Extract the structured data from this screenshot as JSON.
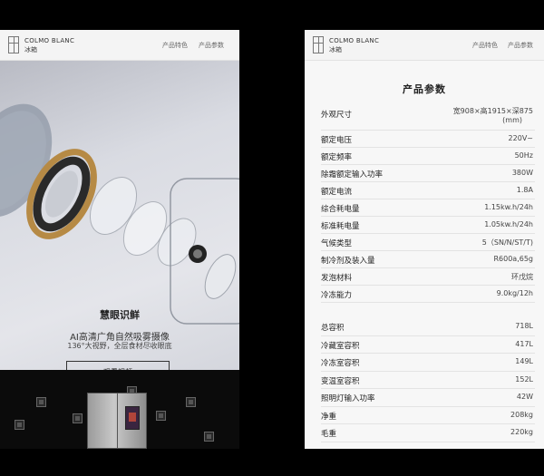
{
  "left": {
    "brand": "COLMO BLANC",
    "brand_sub": "冰箱",
    "nav": [
      "产品特色",
      "产品参数"
    ],
    "hero": {
      "title": "慧眼识鲜",
      "line1": "AI高清广角自然吸雾摄像",
      "line2": "136°大视野，全层食材尽收眼底",
      "button": "观看视频"
    }
  },
  "right": {
    "brand": "COLMO BLANC",
    "brand_sub": "冰箱",
    "nav": [
      "产品特色",
      "产品参数"
    ],
    "title": "产品参数",
    "group1": [
      {
        "label": "外观尺寸",
        "value": "宽908×高1915×深875",
        "value2": "(mm)"
      },
      {
        "label": "额定电压",
        "value": "220V~"
      },
      {
        "label": "额定频率",
        "value": "50Hz"
      },
      {
        "label": "除霜额定输入功率",
        "value": "380W"
      },
      {
        "label": "额定电流",
        "value": "1.8A"
      },
      {
        "label": "综合耗电量",
        "value": "1.15kw.h/24h"
      },
      {
        "label": "标准耗电量",
        "value": "1.05kw.h/24h"
      },
      {
        "label": "气候类型",
        "value": "5（SN/N/ST/T)"
      },
      {
        "label": "制冷剂及装入量",
        "value": "R600a,65g"
      },
      {
        "label": "发泡材料",
        "value": "环戊烷"
      },
      {
        "label": "冷冻能力",
        "value": "9.0kg/12h"
      }
    ],
    "group2": [
      {
        "label": "总容积",
        "value": "718L"
      },
      {
        "label": "冷藏室容积",
        "value": "417L"
      },
      {
        "label": "冷冻室容积",
        "value": "149L"
      },
      {
        "label": "变温室容积",
        "value": "152L"
      },
      {
        "label": "照明灯输入功率",
        "value": "42W"
      },
      {
        "label": "净重",
        "value": "208kg"
      },
      {
        "label": "毛重",
        "value": "220kg"
      }
    ]
  }
}
